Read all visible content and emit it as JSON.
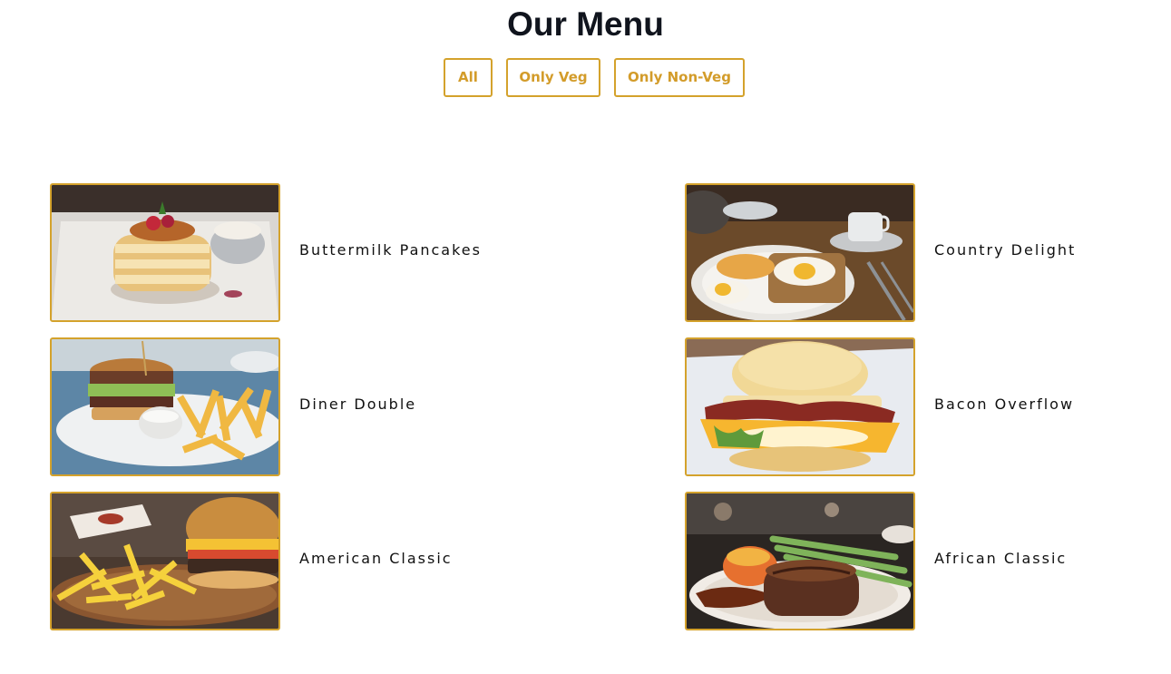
{
  "header": {
    "title": "Our Menu"
  },
  "filters": [
    {
      "label": "All"
    },
    {
      "label": "Only Veg"
    },
    {
      "label": "Only Non-Veg"
    }
  ],
  "menu": {
    "items": [
      {
        "name": "Buttermilk Pancakes",
        "image": "pancakes-photo"
      },
      {
        "name": "Country Delight",
        "image": "eggs-toast-photo"
      },
      {
        "name": "Diner Double",
        "image": "burger-fries-photo"
      },
      {
        "name": "Bacon Overflow",
        "image": "bacon-biscuit-photo"
      },
      {
        "name": "American Classic",
        "image": "burger-board-photo"
      },
      {
        "name": "African Classic",
        "image": "steak-asparagus-photo"
      }
    ]
  },
  "colors": {
    "accent": "#d4a22c",
    "title": "#10141d",
    "text": "#101010",
    "background": "#ffffff"
  }
}
